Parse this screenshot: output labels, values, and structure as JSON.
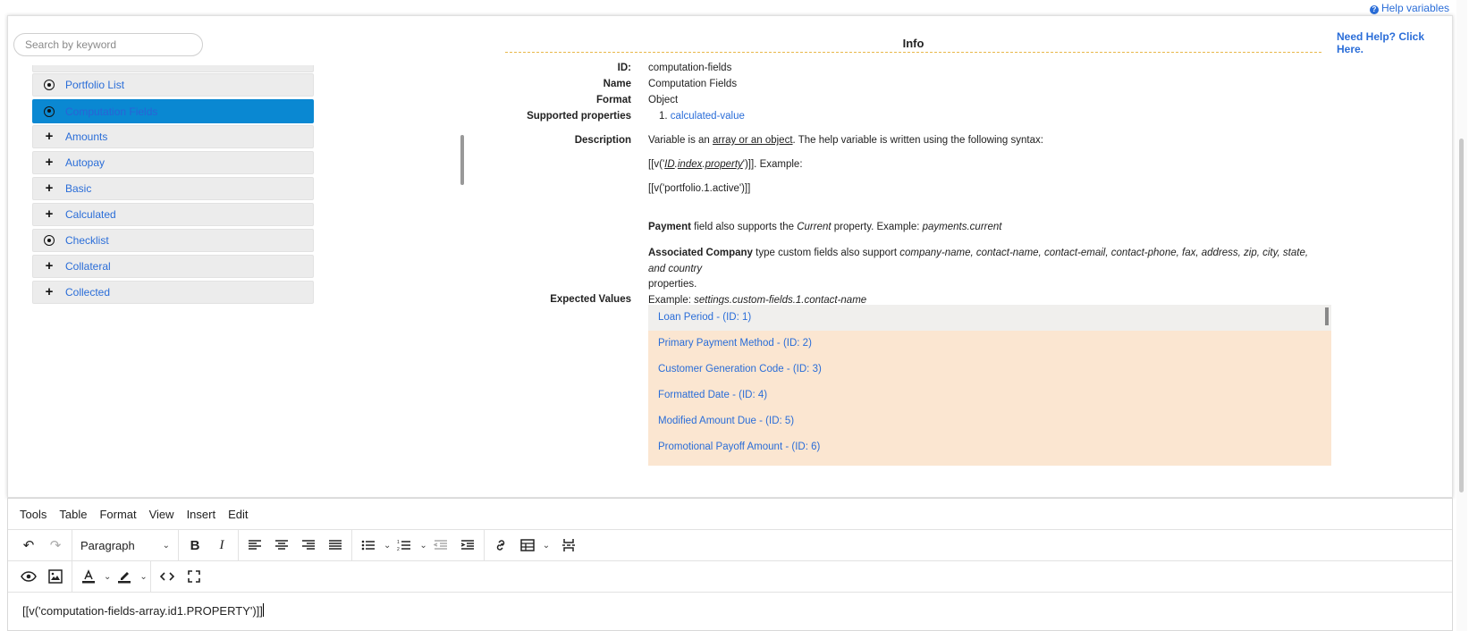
{
  "header": {
    "help_variables": "Help variables"
  },
  "search": {
    "placeholder": "Search by keyword"
  },
  "tree": {
    "items": [
      {
        "label": "Portfolio List",
        "icon": "radio-icon"
      },
      {
        "label": "Computation Fields",
        "icon": "radio-icon",
        "selected": true
      },
      {
        "label": "Amounts",
        "icon": "plus-icon"
      },
      {
        "label": "Autopay",
        "icon": "plus-icon"
      },
      {
        "label": "Basic",
        "icon": "plus-icon"
      },
      {
        "label": "Calculated",
        "icon": "plus-icon"
      },
      {
        "label": "Checklist",
        "icon": "radio-icon"
      },
      {
        "label": "Collateral",
        "icon": "plus-icon"
      },
      {
        "label": "Collected",
        "icon": "plus-icon"
      }
    ]
  },
  "info": {
    "title": "Info",
    "need_help": "Need Help? Click Here.",
    "id_label": "ID:",
    "id_value": "computation-fields",
    "name_label": "Name",
    "name_value": "Computation Fields",
    "format_label": "Format",
    "format_value": "Object",
    "supported_label": "Supported properties",
    "supported_num": "1.",
    "supported_value": "calculated-value",
    "description_label": "Description",
    "desc_line1_a": "Variable is an ",
    "desc_line1_link": "array or an object",
    "desc_line1_b": ". The help variable is written using the following syntax:",
    "desc_line2_a": "[[v('",
    "desc_line2_id": "ID",
    "desc_line2_dot1": ".",
    "desc_line2_index": "index",
    "desc_line2_dot2": ".",
    "desc_line2_prop": "property",
    "desc_line2_b": "')]]. Example:",
    "desc_line3": "[[v('portfolio.1.active')]]",
    "payment_bold": "Payment",
    "payment_a": " field also supports the ",
    "payment_current": "Current",
    "payment_b": " property. Example: ",
    "payment_example": "payments.current",
    "assoc_bold": "Associated Company",
    "assoc_a": " type custom fields also support ",
    "assoc_props": "company-name, contact-name, contact-email, contact-phone, fax, address, zip, city, state, and country",
    "assoc_b": "properties.",
    "assoc_example_label": "Example: ",
    "assoc_example": "settings.custom-fields.1.contact-name",
    "expected_label": "Expected Values",
    "expected_values": [
      "Loan Period - (ID: 1)",
      "Primary Payment Method - (ID: 2)",
      "Customer Generation Code - (ID: 3)",
      "Formatted Date - (ID: 4)",
      "Modified Amount Due - (ID: 5)",
      "Promotional Payoff Amount - (ID: 6)"
    ]
  },
  "editor": {
    "menu": [
      "Tools",
      "Table",
      "Format",
      "View",
      "Insert",
      "Edit"
    ],
    "block_format": "Paragraph",
    "content": "[[v('computation-fields-array.id1.PROPERTY')]]"
  },
  "colors": {
    "accent": "#2a6dd8",
    "selected_bg": "#0a88d2",
    "expected_bg": "#fbe6d1",
    "rule": "#e8b84a"
  }
}
